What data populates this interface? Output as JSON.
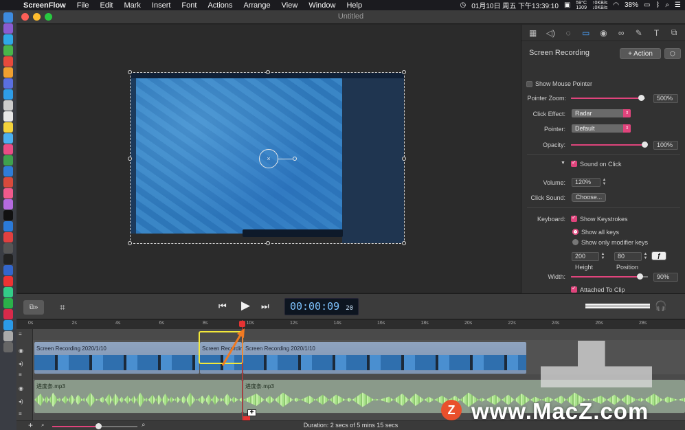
{
  "menubar": {
    "app": "ScreenFlow",
    "menus": [
      "File",
      "Edit",
      "Mark",
      "Insert",
      "Font",
      "Actions",
      "Arrange",
      "View",
      "Window",
      "Help"
    ],
    "clock": "01月10日 周五 下午13:39:10",
    "temp": "59°C",
    "fan": "1309",
    "net_up": "↑0KB/s",
    "net_down": "↓0KB/s",
    "battery": "38%"
  },
  "window": {
    "title": "Untitled"
  },
  "inspector": {
    "title": "Screen Recording",
    "add_action": "+ Action",
    "show_mouse_pointer": "Show Mouse Pointer",
    "pointer_zoom_label": "Pointer Zoom:",
    "pointer_zoom_value": "500%",
    "pointer_zoom_level": 0.95,
    "click_effect_label": "Click Effect:",
    "click_effect_value": "Radar",
    "pointer_label": "Pointer:",
    "pointer_value": "Default",
    "opacity_label": "Opacity:",
    "opacity_value": "100%",
    "opacity_level": 1.0,
    "sound_on_click": "Sound on Click",
    "volume_label": "Volume:",
    "volume_value": "120%",
    "click_sound_label": "Click Sound:",
    "choose_button": "Choose...",
    "keyboard_label": "Keyboard:",
    "show_keystrokes": "Show Keystrokes",
    "show_all_keys": "Show all keys",
    "show_modifier_keys": "Show only modifier keys",
    "height_value": "200",
    "position_value": "80",
    "height_label": "Height",
    "position_label": "Position",
    "width_label": "Width:",
    "width_value": "90%",
    "width_level": 0.9,
    "attached_to_clip": "Attached To Clip"
  },
  "transport": {
    "timecode": "00:00:09",
    "frames": "20"
  },
  "timeline": {
    "ticks": [
      "0s",
      "2s",
      "4s",
      "6s",
      "8s",
      "10s",
      "12s",
      "14s",
      "16s",
      "18s",
      "20s",
      "22s",
      "24s",
      "26s",
      "28s"
    ],
    "video_clips": [
      "Screen Recording 2020/1/10",
      "Screen Recording",
      "Screen Recording 2020/1/10"
    ],
    "audio_clips": [
      "进度条.mp3",
      "进度条.mp3"
    ],
    "duration": "Duration: 2 secs of 5 mins 15 secs",
    "zoom_level": 0.55
  },
  "watermark": {
    "text": "www.MacZ.com",
    "logo": "Z"
  },
  "colors": {
    "accent": "#e0447c",
    "selection": "#f3e83a",
    "playhead": "#e63333",
    "timecode": "#7fc4ff"
  }
}
